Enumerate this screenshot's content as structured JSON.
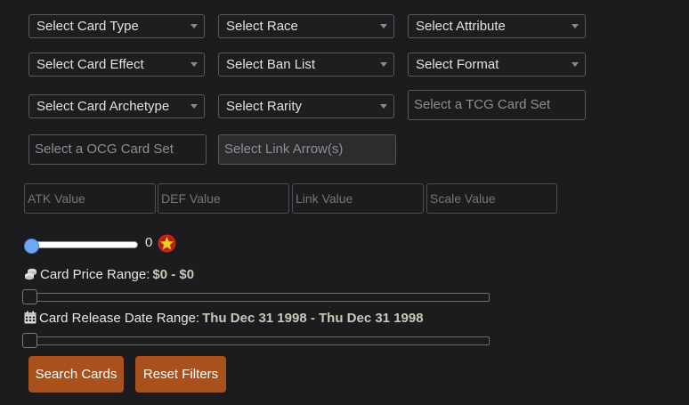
{
  "filters": {
    "card_type": {
      "value": "Select Card Type"
    },
    "race": {
      "value": "Select Race"
    },
    "attribute": {
      "value": "Select Attribute"
    },
    "card_effect": {
      "value": "Select Card Effect"
    },
    "ban_list": {
      "value": "Select Ban List"
    },
    "format": {
      "value": "Select Format"
    },
    "archetype": {
      "value": "Select Card Archetype"
    },
    "rarity": {
      "value": "Select Rarity"
    },
    "tcg_set": {
      "placeholder": "Select a TCG Card Set"
    },
    "ocg_set": {
      "placeholder": "Select a OCG Card Set"
    },
    "link_arrows": {
      "placeholder": "Select Link Arrow(s)"
    }
  },
  "stats": {
    "atk": {
      "placeholder": "ATK Value"
    },
    "def": {
      "placeholder": "DEF Value"
    },
    "link": {
      "placeholder": "Link Value"
    },
    "scale": {
      "placeholder": "Scale Value"
    }
  },
  "level_slider": {
    "value": "0",
    "fraction": 0,
    "icon": "level-star-icon"
  },
  "price_range": {
    "label": "Card Price Range:",
    "value": "$0 - $0",
    "icon": "coins-icon",
    "fraction": 0
  },
  "date_range": {
    "label": "Card Release Date Range:",
    "value": "Thu Dec 31 1998 - Thu Dec 31 1998",
    "icon": "calendar-icon",
    "fraction": 0
  },
  "buttons": {
    "search": "Search Cards",
    "reset": "Reset Filters"
  },
  "colors": {
    "background": "#1c1c1e",
    "button": "#a8511c",
    "slider_thumb": "#6fa8f0",
    "range_value": "#c9c7b8"
  }
}
